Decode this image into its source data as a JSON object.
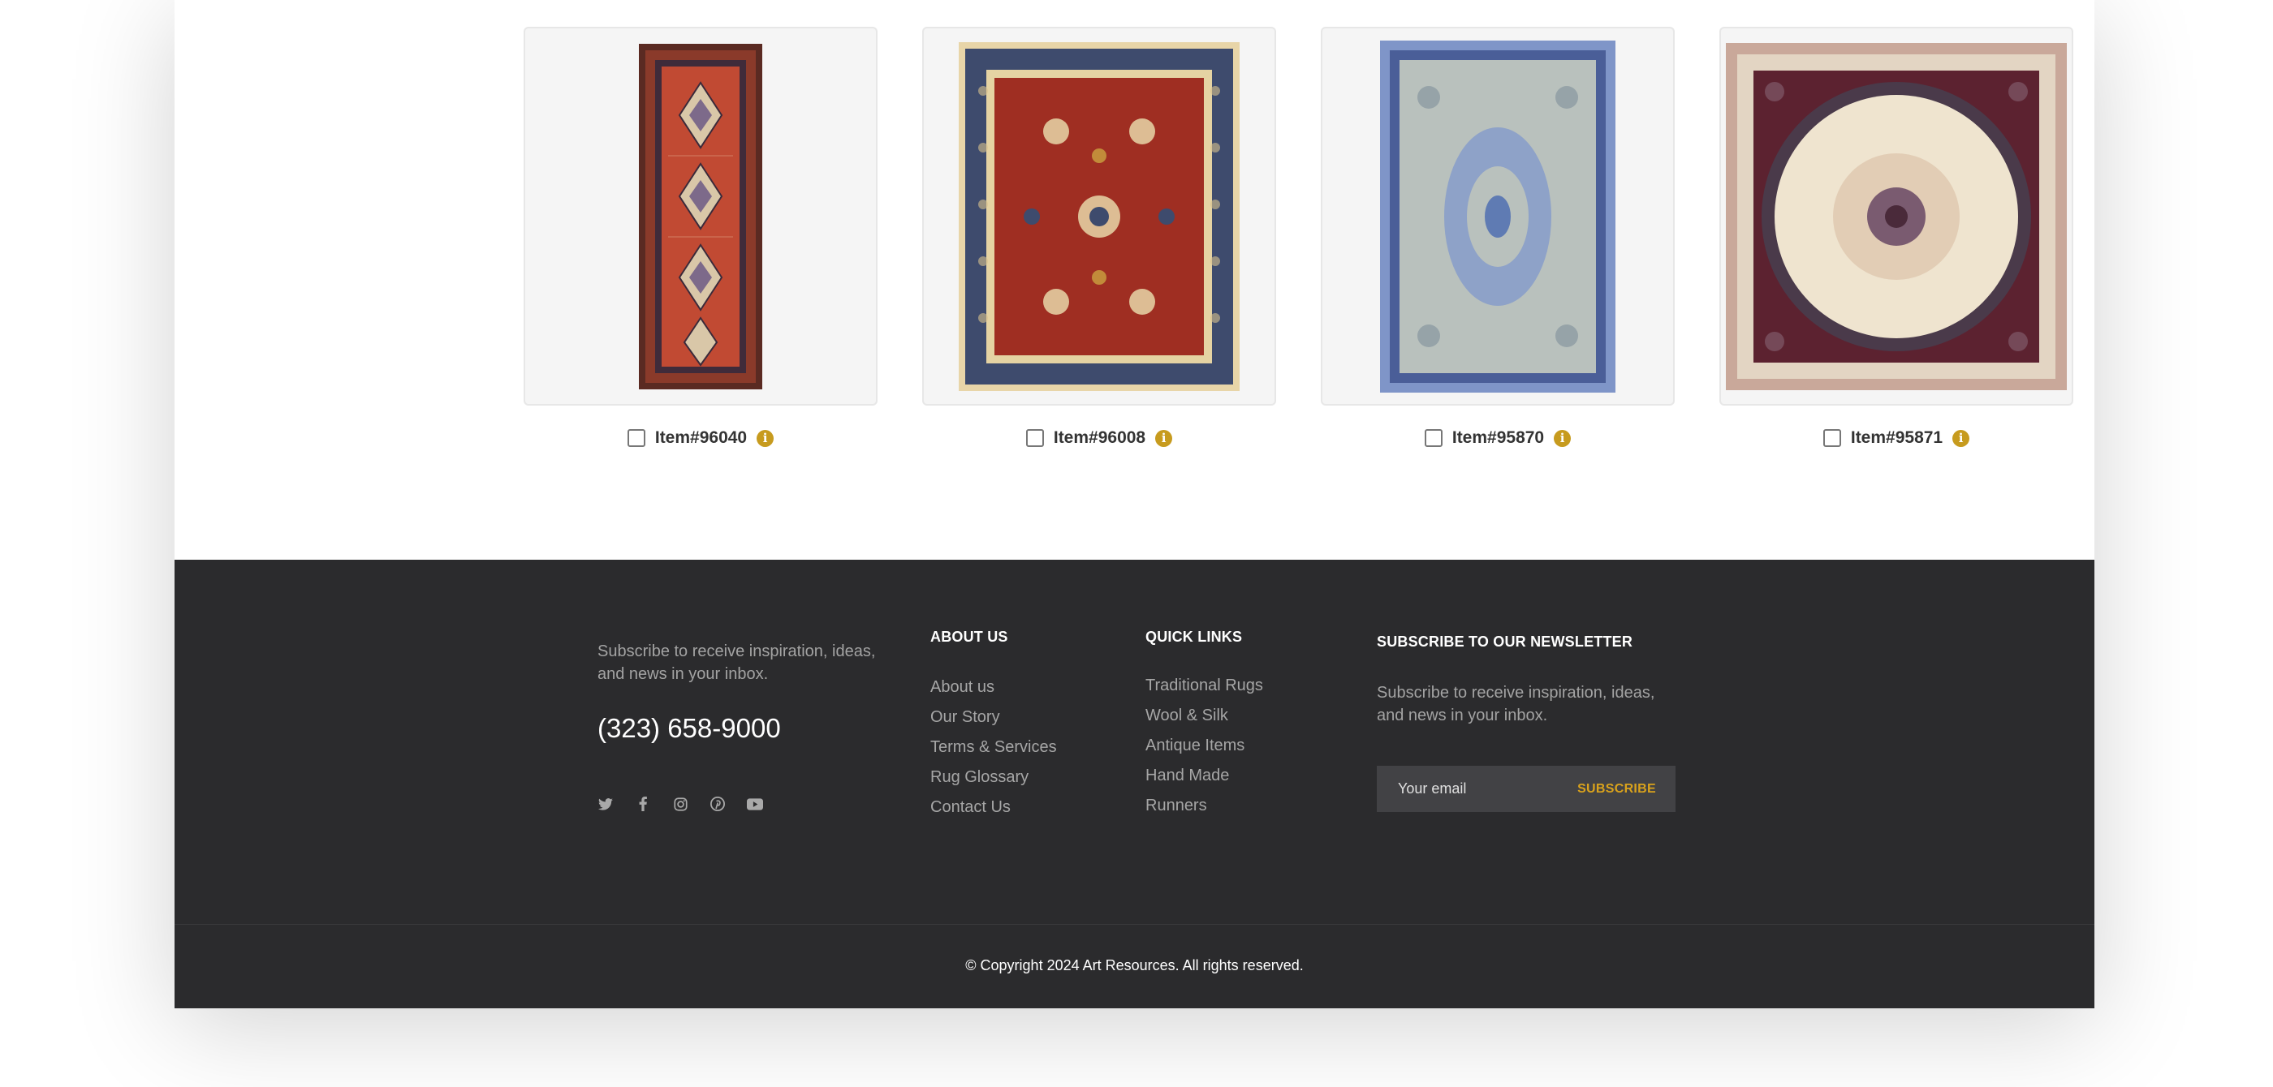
{
  "products": [
    {
      "item_number": "Item#96040"
    },
    {
      "item_number": "Item#96008"
    },
    {
      "item_number": "Item#95870"
    },
    {
      "item_number": "Item#95871"
    }
  ],
  "footer": {
    "tagline": "Subscribe to receive inspiration, ideas, and news in your inbox.",
    "phone": "(323) 658-9000",
    "socials": [
      "twitter-icon",
      "facebook-icon",
      "instagram-icon",
      "pinterest-icon",
      "youtube-icon"
    ],
    "about": {
      "heading": "ABOUT US",
      "links": [
        "About us",
        "Our Story",
        "Terms & Services",
        "Rug Glossary",
        "Contact Us"
      ]
    },
    "quick_links": {
      "heading": "QUICK LINKS",
      "links": [
        "Traditional Rugs",
        "Wool & Silk",
        "Antique Items",
        "Hand Made",
        "Runners"
      ]
    },
    "newsletter": {
      "heading": "SUBSCRIBE TO OUR NEWSLETTER",
      "text": "Subscribe to receive inspiration, ideas, and news in your inbox.",
      "email_placeholder": "Your email",
      "subscribe_label": "SUBSCRIBE"
    },
    "copyright": "© Copyright 2024 Art Resources. All rights reserved."
  },
  "colors": {
    "footer_bg": "#2b2b2d",
    "accent": "#d9a21c",
    "info_icon": "#c79b1e"
  }
}
